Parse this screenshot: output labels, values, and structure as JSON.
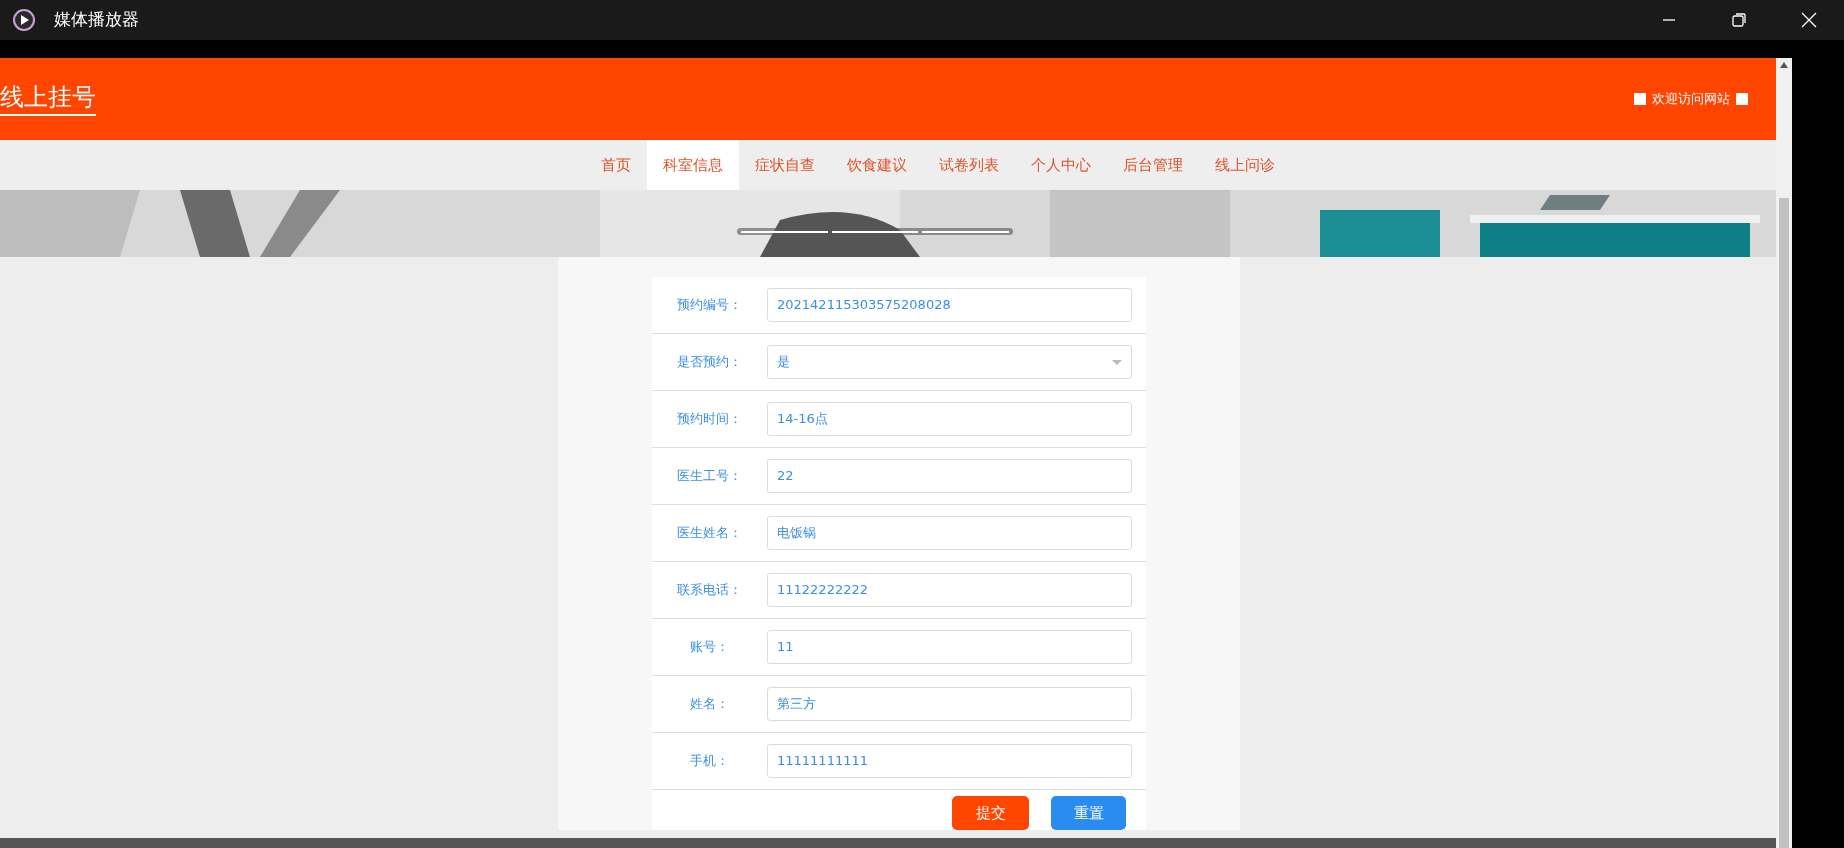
{
  "window": {
    "title": "媒体播放器"
  },
  "site": {
    "logo": "线上挂号",
    "welcome": "欢迎访问网站"
  },
  "nav": [
    {
      "label": "首页",
      "selected": false
    },
    {
      "label": "科室信息",
      "selected": true
    },
    {
      "label": "症状自查",
      "selected": false
    },
    {
      "label": "饮食建议",
      "selected": false
    },
    {
      "label": "试卷列表",
      "selected": false
    },
    {
      "label": "个人中心",
      "selected": false
    },
    {
      "label": "后台管理",
      "selected": false
    },
    {
      "label": "线上问诊",
      "selected": false
    }
  ],
  "form": {
    "fields": [
      {
        "label": "预约编号：",
        "value": "202142115303575208028",
        "kind": "input"
      },
      {
        "label": "是否预约：",
        "value": "是",
        "kind": "select"
      },
      {
        "label": "预约时间：",
        "value": "14-16点",
        "kind": "input"
      },
      {
        "label": "医生工号：",
        "value": "22",
        "kind": "input"
      },
      {
        "label": "医生姓名：",
        "value": "电饭锅",
        "kind": "input"
      },
      {
        "label": "联系电话：",
        "value": "11122222222",
        "kind": "input"
      },
      {
        "label": "账号：",
        "value": "11",
        "kind": "input"
      },
      {
        "label": "姓名：",
        "value": "第三方",
        "kind": "input"
      },
      {
        "label": "手机：",
        "value": "11111111111",
        "kind": "input"
      }
    ],
    "buttons": [
      {
        "label": "提交",
        "kind": "primary"
      },
      {
        "label": "重置",
        "kind": "secondary"
      }
    ]
  }
}
